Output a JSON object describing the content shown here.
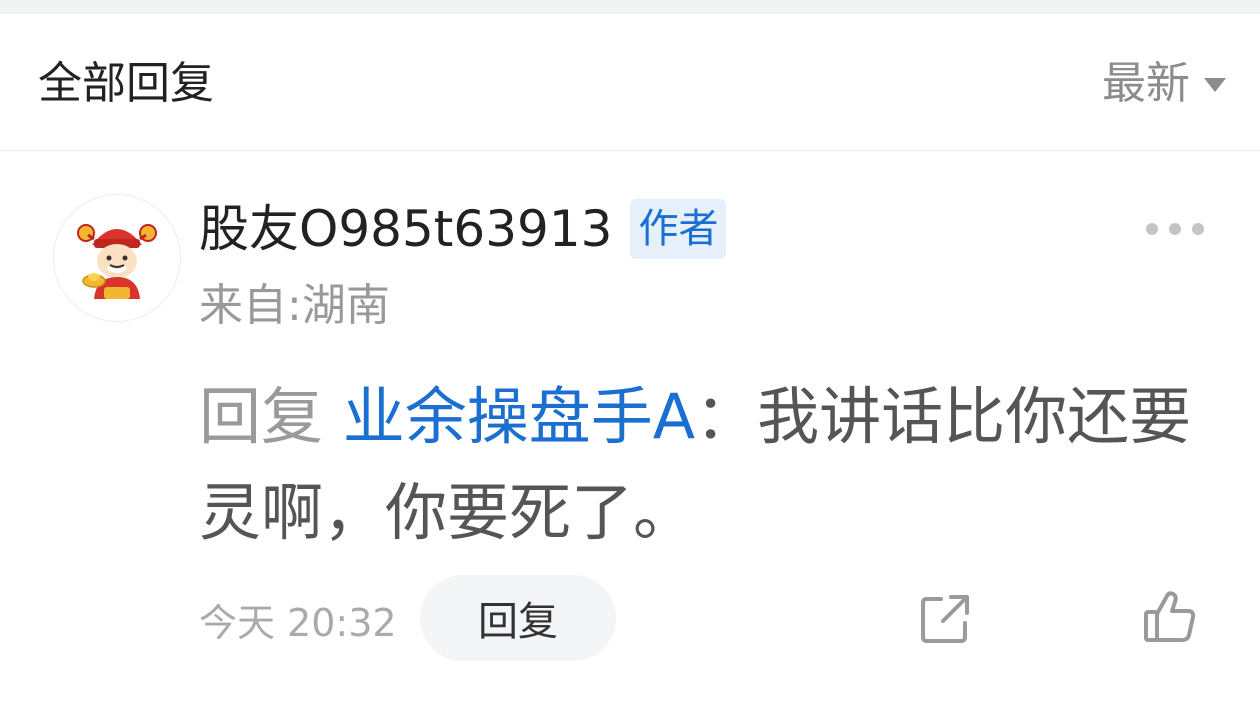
{
  "header": {
    "title": "全部回复",
    "sort_label": "最新",
    "sort_icon": "caret-down-icon"
  },
  "comment": {
    "username": "股友O985t63913",
    "badge": "作者",
    "location": "来自:湖南",
    "reply_prefix": "回复 ",
    "reply_target": "业余操盘手A",
    "reply_separator": "：",
    "text": "我讲话比你还要灵啊，你要死了。",
    "time": "今天 20:32",
    "reply_button": "回复",
    "icons": [
      "more-icon",
      "share-icon",
      "like-icon"
    ]
  },
  "colors": {
    "accent": "#1a6fd1",
    "badge_bg": "#e6f0fb",
    "muted": "#999999",
    "divider": "#ececec"
  }
}
